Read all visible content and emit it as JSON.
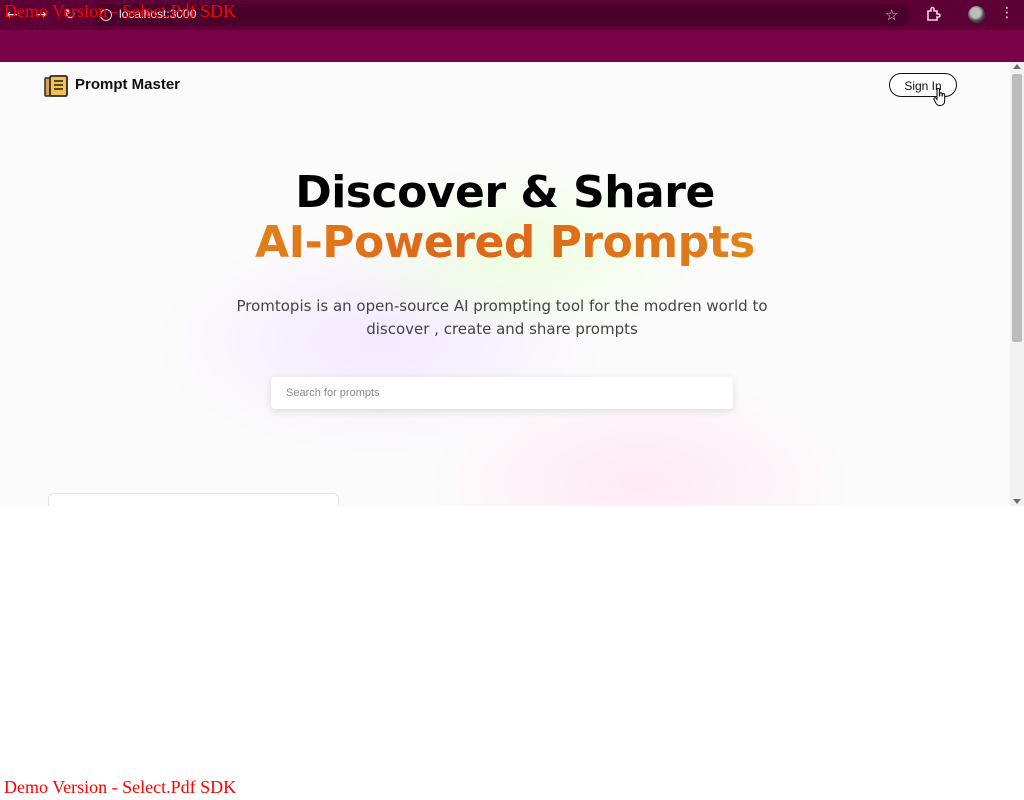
{
  "watermark": {
    "top": "Demo Version - Select.Pdf SDK",
    "bottom": "Demo Version - Select.Pdf SDK"
  },
  "browser": {
    "url": "localhost:3000",
    "icons": [
      "back-icon",
      "forward-icon",
      "reload-icon",
      "site-info-icon",
      "bookmark-star-icon",
      "extensions-icon",
      "profile-avatar",
      "kebab-menu-icon"
    ],
    "chrome_color": "#7a0048"
  },
  "header": {
    "logo_text": "Prompt Master",
    "signin_label": "Sign In"
  },
  "hero": {
    "title_line1": "Discover & Share",
    "title_line2": "AI-Powered Prompts",
    "description": "Promtopis is an open-source AI prompting tool for the modren world to discover , create and share prompts",
    "gradient_colors": [
      "#e3a21a",
      "#e0641a",
      "#e4c21e"
    ]
  },
  "search": {
    "placeholder": "Search for prompts",
    "value": ""
  }
}
